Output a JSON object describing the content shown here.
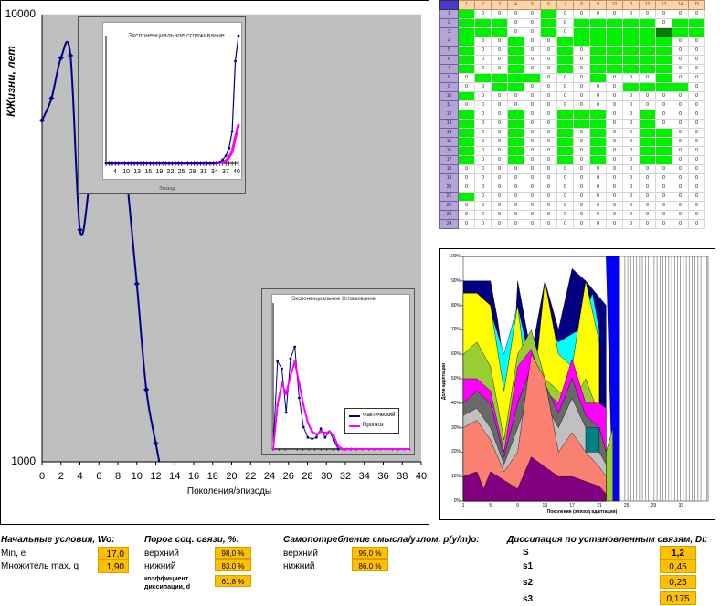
{
  "chart_data": [
    {
      "type": "line",
      "ylabel": "КЖизни, лет",
      "xlabel": "Поколения/эпизоды",
      "yscale": "log",
      "ylim": [
        1000,
        10000
      ],
      "xlim": [
        0,
        40
      ],
      "y_ticks": [
        "10000",
        "1000"
      ],
      "x_ticks": [
        "0",
        "2",
        "4",
        "6",
        "8",
        "10",
        "12",
        "14",
        "16",
        "18",
        "20",
        "22",
        "24",
        "26",
        "28",
        "30",
        "32",
        "34",
        "36",
        "38",
        "40"
      ],
      "series": [
        {
          "color": "#00008b",
          "x": [
            0,
            1,
            2,
            3,
            4,
            5,
            6,
            7,
            8,
            9,
            10,
            11,
            12,
            13
          ],
          "y": [
            5800,
            6500,
            8000,
            8100,
            3300,
            4200,
            6600,
            8150,
            6800,
            4200,
            2500,
            1450,
            1100,
            850
          ]
        }
      ]
    },
    {
      "type": "line",
      "title": "Экспоненциальное сглаживание",
      "xlabel": "Эпизод",
      "x_ticks": [
        "4",
        "10",
        "13",
        "16",
        "19",
        "22",
        "25",
        "28",
        "31",
        "34",
        "37",
        "40"
      ],
      "series": [
        {
          "color": "#00008b",
          "values": [
            0,
            0,
            0,
            0,
            0,
            0,
            0,
            0,
            0,
            0,
            0,
            0,
            0,
            0,
            0,
            0,
            0,
            0,
            0,
            0,
            0,
            0,
            0,
            0,
            0,
            0,
            0,
            0,
            0,
            0,
            0,
            0,
            0,
            0,
            0,
            0.5,
            1,
            3,
            6,
            12,
            25,
            80,
            100
          ]
        },
        {
          "color": "#ff00ff",
          "values": [
            0,
            0,
            0,
            0,
            0,
            0,
            0,
            0,
            0,
            0,
            0,
            0,
            0,
            0,
            0,
            0,
            0,
            0,
            0,
            0,
            0,
            0,
            0,
            0,
            0,
            0,
            0,
            0,
            0,
            0,
            0,
            0,
            0,
            0,
            0,
            0,
            0.5,
            1,
            2,
            5,
            9,
            20,
            30
          ]
        }
      ]
    },
    {
      "type": "line",
      "title": "Экспоненциальное Сглаживание",
      "legend": [
        "Фактический",
        "Прогноз"
      ],
      "series": [
        {
          "name": "Фактический",
          "color": "#00008b",
          "values": [
            0,
            60,
            55,
            25,
            62,
            70,
            35,
            15,
            8,
            7,
            8,
            14,
            8,
            12,
            6,
            0,
            0,
            0,
            0,
            0
          ]
        },
        {
          "name": "Прогноз",
          "color": "#ff00ff",
          "values": [
            0,
            30,
            45,
            38,
            50,
            60,
            45,
            30,
            18,
            12,
            10,
            12,
            11,
            12,
            9,
            2,
            0,
            0,
            0,
            0
          ]
        }
      ]
    },
    {
      "type": "area",
      "ylabel": "Доля адаптации",
      "xlabel": "Поколения (эпизод адаптации)",
      "y_ticks": [
        "100%",
        "90%",
        "80%",
        "70%",
        "60%",
        "50%",
        "40%",
        "30%",
        "20%",
        "10%",
        "0%"
      ],
      "x_ticks": [
        "1",
        "5",
        "9",
        "13",
        "17",
        "21",
        "25",
        "29",
        "33"
      ],
      "colors": [
        "#800080",
        "#008080",
        "#fa8072",
        "#c0c0c0",
        "#696969",
        "#ff00ff",
        "#9acd32",
        "#ffff00",
        "#00ffff",
        "#000080",
        "#0000ff",
        "#ffffff"
      ]
    }
  ],
  "matrix": {
    "columns": [
      "1",
      "2",
      "3",
      "4",
      "5",
      "6",
      "7",
      "8",
      "9",
      "10",
      "11",
      "12",
      "13",
      "14",
      "15"
    ],
    "rows": [
      {
        "label": "1",
        "cells": "gzzzzgzzzzzzzzz"
      },
      {
        "label": "2",
        "cells": "gggzzgzgggggzgg"
      },
      {
        "label": "3",
        "cells": "gggzzgzgggggdgg"
      },
      {
        "label": "4",
        "cells": "gzzgzzgggggggzz"
      },
      {
        "label": "5",
        "cells": "gzzgzzgzgggggzz"
      },
      {
        "label": "6",
        "cells": "gzzgzzgzgggggzz"
      },
      {
        "label": "7",
        "cells": "gzzgzzgzgggggzz"
      },
      {
        "label": "8",
        "cells": "zggggzzzgzzzgzz"
      },
      {
        "label": "9",
        "cells": "zzggzzzzzzggggz"
      },
      {
        "label": "10",
        "cells": "gzzzzzzzzzzzzzz"
      },
      {
        "label": "11",
        "cells": "zzzzzzzzzzzzzzz"
      },
      {
        "label": "12",
        "cells": "gzzgzzgggzzgzzz"
      },
      {
        "label": "13",
        "cells": "gzzgzzgggzzgzzz"
      },
      {
        "label": "14",
        "cells": "gzzgzzgzgzzggzz"
      },
      {
        "label": "15",
        "cells": "gzzgzzgzgzzggzz"
      },
      {
        "label": "16",
        "cells": "gzzgzzgzgzzggzz"
      },
      {
        "label": "17",
        "cells": "gzzgzzgzgzzggzz"
      },
      {
        "label": "18",
        "cells": "zzzzzzzzzzzzzzz"
      },
      {
        "label": "19",
        "cells": "zzzzzzzzzzzzzzz"
      },
      {
        "label": "20",
        "cells": "zzzzzzzzzzzzzzz"
      },
      {
        "label": "21",
        "cells": "gzzzzzzzzzzzzzz"
      },
      {
        "label": "22",
        "cells": "zzzzzzzzzzzzzzz"
      },
      {
        "label": "23",
        "cells": "zzzzzzzzzzzzzzz"
      },
      {
        "label": "24",
        "cells": "zzzzzzzzzzzzzzz"
      }
    ]
  },
  "params": {
    "initial": {
      "title": "Начальные условия, Wo:",
      "min_label": "Min, e",
      "min_value": "17,0",
      "mult_label": "Множитель max, q",
      "mult_value": "1,90"
    },
    "threshold": {
      "title": "Порог соц. связи, %:",
      "upper_label": "верхний",
      "upper_value": "98,0 %",
      "lower_label": "нижний",
      "lower_value": "83,0 %",
      "coef_label": "коэффициент диссипации, d",
      "coef_value": "61,8 %"
    },
    "selfcons": {
      "title": "Самопотребление смысла/узлом, p(y/m)o:",
      "upper_label": "верхний",
      "upper_value": "95,0 %",
      "lower_label": "нижний",
      "lower_value": "86,0 %"
    },
    "dissipation": {
      "title": "Диссипация по установленным связям, Di:",
      "rows": [
        {
          "label": "S",
          "value": "1,2"
        },
        {
          "label": "s1",
          "value": "0,45"
        },
        {
          "label": "s2",
          "value": "0,25"
        },
        {
          "label": "s3",
          "value": "0,175"
        }
      ]
    }
  }
}
